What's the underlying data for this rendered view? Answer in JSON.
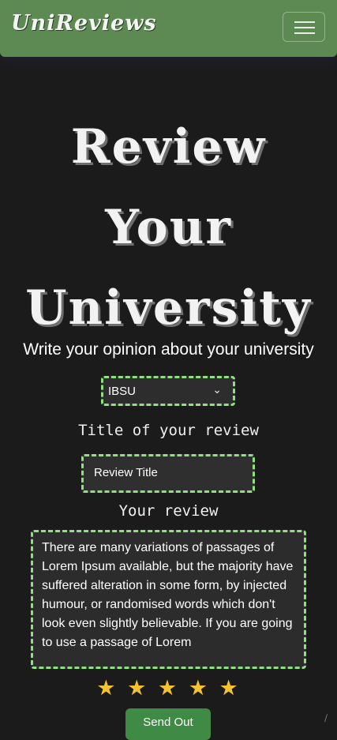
{
  "navbar": {
    "brand": "UniReviews",
    "toggle_icon": "hamburger-menu-icon",
    "bg_color": "#5d8a52"
  },
  "hero": {
    "line1": "Review",
    "line2": "Your",
    "line3": "University",
    "subtitle": "Write your opinion about your university"
  },
  "form": {
    "university_select": {
      "selected": "IBSU",
      "icon": "chevron-down-icon"
    },
    "title_label": "Title of your review",
    "title_value": "Review Title",
    "review_label": "Your review",
    "review_text": "There are many variations of passages of Lorem Ipsum available, but the majority have suffered alteration in some form, by injected humour, or randomised words which don't look even slightly believable. If you are going to use a passage of Lorem",
    "rating": 5,
    "rating_icon": "star-icon",
    "submit_label": "Send Out",
    "accent_color": "#8fe07f",
    "star_color": "#f2c230"
  }
}
